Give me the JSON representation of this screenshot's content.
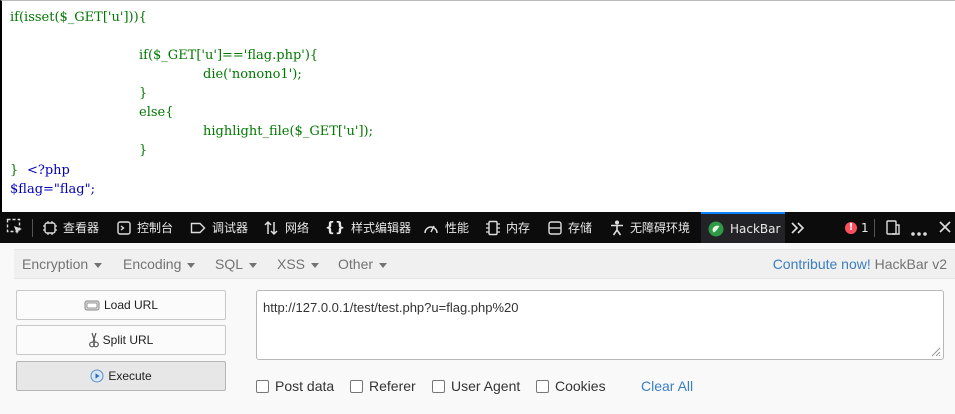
{
  "code": {
    "lines": [
      "if(isset($_GET['u'])){",
      "if($_GET['u']=='flag.php'){",
      "die('nonono1');",
      "}",
      "else{",
      "highlight_file($_GET['u']);",
      "}",
      "}",
      "<?php",
      "$flag=\"flag\";"
    ],
    "colors": {
      "keyword": "#007700",
      "default": "#0000BB",
      "string": "#DD0000"
    }
  },
  "devtools": {
    "tabs": [
      {
        "label": "查看器",
        "icon": "inspector-icon"
      },
      {
        "label": "控制台",
        "icon": "console-icon"
      },
      {
        "label": "调试器",
        "icon": "debugger-icon"
      },
      {
        "label": "网络",
        "icon": "network-icon"
      },
      {
        "label": "样式编辑器",
        "icon": "style-editor-icon"
      },
      {
        "label": "性能",
        "icon": "performance-icon"
      },
      {
        "label": "内存",
        "icon": "memory-icon"
      },
      {
        "label": "存储",
        "icon": "storage-icon"
      },
      {
        "label": "无障碍环境",
        "icon": "accessibility-icon"
      },
      {
        "label": "HackBar",
        "icon": "hackbar-icon",
        "active": true
      }
    ],
    "error_count": "1",
    "accent": "#0a84ff"
  },
  "hackbar": {
    "menus": [
      "Encryption",
      "Encoding",
      "SQL",
      "XSS",
      "Other"
    ],
    "contribute": "Contribute now!",
    "brand": "HackBar v2",
    "buttons": {
      "load": "Load URL",
      "split": "Split URL",
      "execute": "Execute"
    },
    "url": "http://127.0.0.1/test/test.php?u=flag.php%20",
    "options": [
      "Post data",
      "Referer",
      "User Agent",
      "Cookies"
    ],
    "clear_all": "Clear All"
  }
}
